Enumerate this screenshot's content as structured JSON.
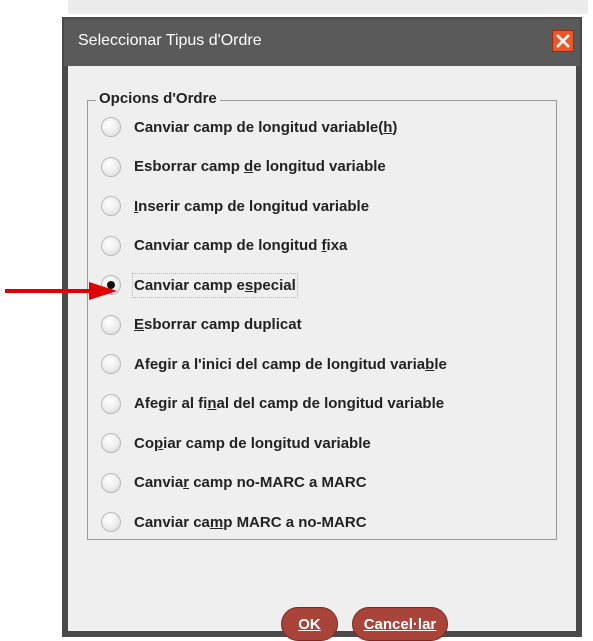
{
  "dialog": {
    "title": "Seleccionar Tipus d'Ordre",
    "group_title": "Opcions d'Ordre",
    "options": [
      {
        "pre": "Canviar camp de longitud variable(",
        "mn": "h",
        "post": ")",
        "selected": false
      },
      {
        "pre": "Esborrar camp ",
        "mn": "d",
        "post": "e longitud variable",
        "selected": false
      },
      {
        "pre": "",
        "mn": "I",
        "post": "nserir camp de longitud variable",
        "selected": false
      },
      {
        "pre": "Canviar camp de longitud ",
        "mn": "f",
        "post": "ixa",
        "selected": false
      },
      {
        "pre": "Canviar camp e",
        "mn": "s",
        "post": "pecial",
        "selected": true
      },
      {
        "pre": "",
        "mn": "E",
        "post": "sborrar camp duplicat",
        "selected": false
      },
      {
        "pre": "Afegir a l'inici del camp de longitud varia",
        "mn": "b",
        "post": "le",
        "selected": false
      },
      {
        "pre": "Afegir al fi",
        "mn": "n",
        "post": "al del camp de longitud variable",
        "selected": false
      },
      {
        "pre": "Co",
        "mn": "p",
        "post": "iar camp de longitud variable",
        "selected": false
      },
      {
        "pre": "Canvia",
        "mn": "r",
        "post": " camp no-MARC a MARC",
        "selected": false
      },
      {
        "pre": "Canviar ca",
        "mn": "m",
        "post": "p MARC a no-MARC",
        "selected": false
      }
    ],
    "ok_label": "OK",
    "cancel_label": "Cancel·lar"
  },
  "colors": {
    "title_bar": "#5a5a5a",
    "button": "#a8443a",
    "close": "#e8562a",
    "arrow": "#e00000"
  },
  "icons": {
    "close": "close-icon",
    "annotation": "red-arrow-icon"
  }
}
